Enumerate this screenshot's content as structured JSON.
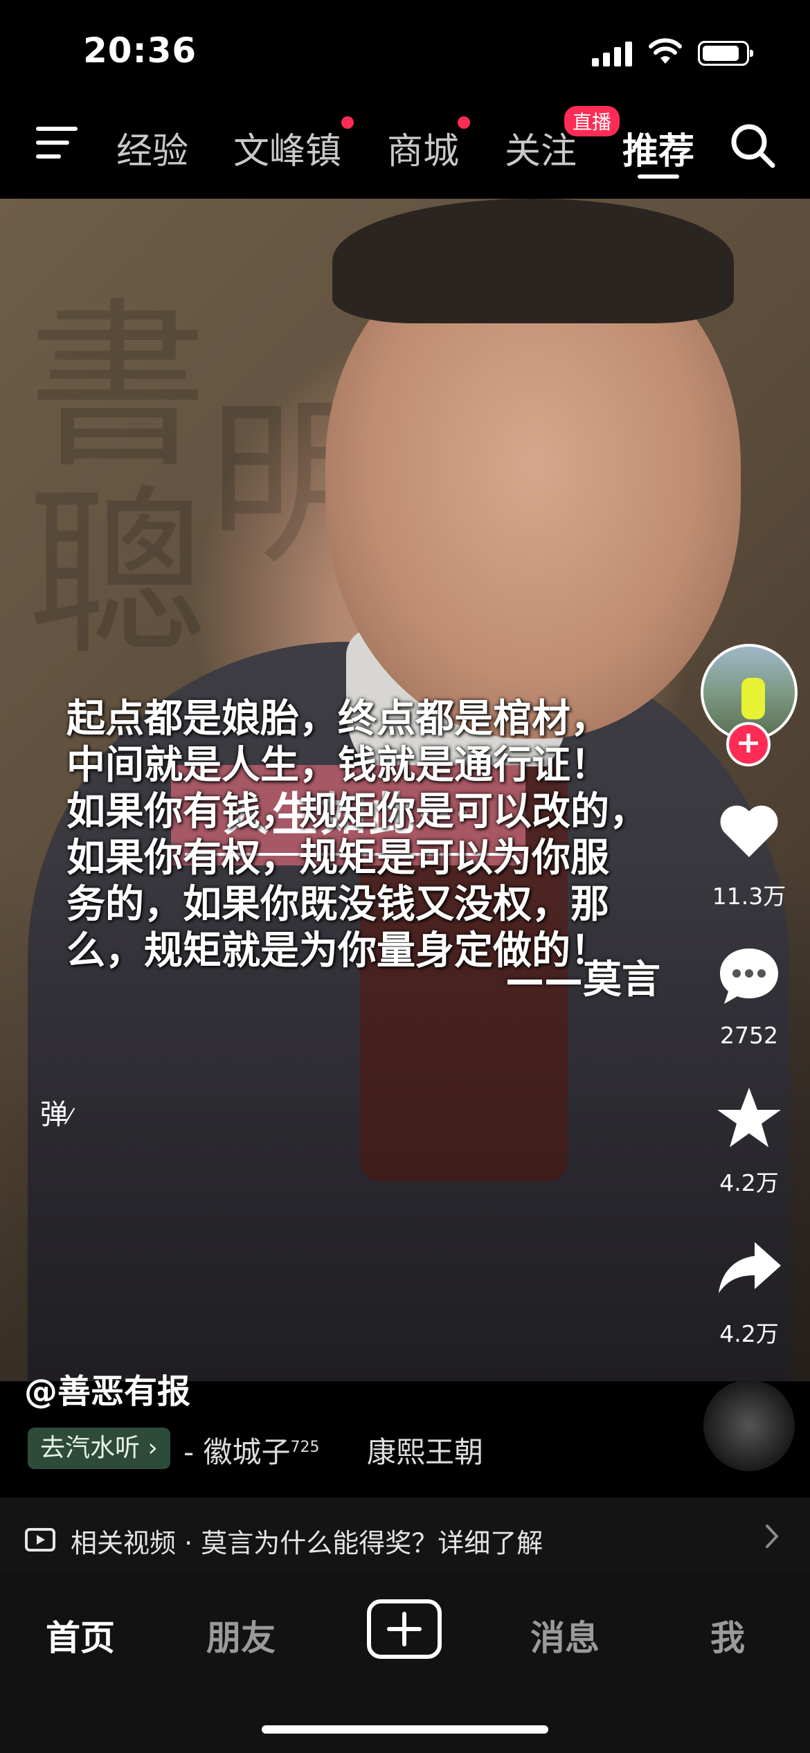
{
  "status": {
    "time": "20:36"
  },
  "nav": {
    "tabs": [
      {
        "label": "经验",
        "dot": false
      },
      {
        "label": "文峰镇",
        "dot": true
      },
      {
        "label": "商城",
        "dot": true
      },
      {
        "label": "关注",
        "badge": "直播"
      },
      {
        "label": "推荐",
        "active": true
      }
    ]
  },
  "video": {
    "title": "人生如此···",
    "quote": "起点都是娘胎，终点都是棺材，\n中间就是人生，钱就是通行证！\n如果你有钱，规矩你是可以改的，\n如果你有权，规矩是可以为你服\n务的，如果你既没钱又没权，那\n么，规矩就是为你量身定做的！",
    "author_line": "——莫言",
    "danmu_label": "弹"
  },
  "rail": {
    "like_count": "11.3万",
    "comment_count": "2752",
    "favorite_count": "4.2万",
    "share_count": "4.2万"
  },
  "info": {
    "author": "@善恶有报",
    "music_chip": "去汽水听 ›",
    "music_artist": "- 徽城子",
    "music_artist_sup": "725",
    "music_song": "康熙王朝"
  },
  "related": {
    "text": "相关视频 · 莫言为什么能得奖？详细了解"
  },
  "tabbar": {
    "home": "首页",
    "friends": "朋友",
    "messages": "消息",
    "me": "我"
  },
  "colors": {
    "accent": "#fe2c55",
    "chip": "#2e4b3a"
  }
}
